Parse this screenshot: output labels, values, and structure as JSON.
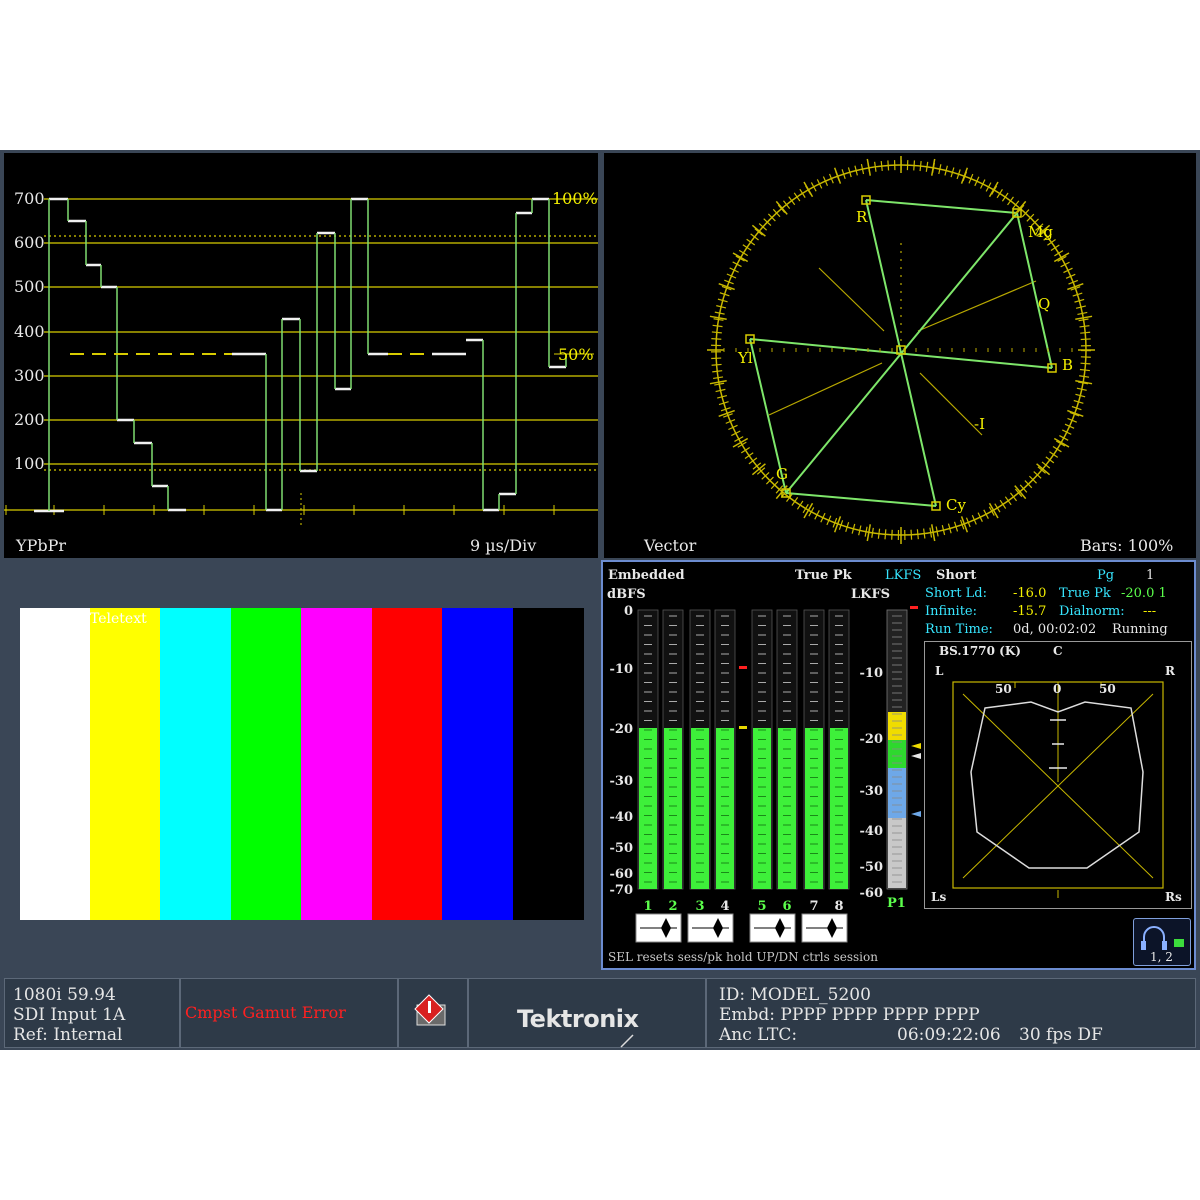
{
  "waveform": {
    "y_ticks": [
      "700",
      "600",
      "500",
      "400",
      "300",
      "200",
      "100"
    ],
    "pct_100": "100%",
    "pct_50": "50%",
    "mode": "YPbPr",
    "timebase": "9 µs/Div"
  },
  "vector": {
    "title": "Vector",
    "bars": "Bars: 100%",
    "targets": {
      "r": "R",
      "mg": "Mg",
      "q": "Q",
      "b": "B",
      "yl": "Yl",
      "i": "-I",
      "g": "G",
      "cy": "Cy"
    }
  },
  "picture": {
    "colors": [
      "#ffffff",
      "#ffff00",
      "#00ffff",
      "#00ff00",
      "#ff00ff",
      "#ff0000",
      "#0000ff",
      "#000000"
    ],
    "overlay": "Teletext"
  },
  "audio": {
    "source": "Embedded",
    "true_pk": "True Pk",
    "lkfs_mode": "LKFS",
    "unit_left": "dBFS",
    "unit_right": "LKFS",
    "dbfs_ticks": [
      "0",
      "-10",
      "-20",
      "-30",
      "-40",
      "-50",
      "-60",
      "-70"
    ],
    "lkfs_ticks": [
      "-10",
      "-20",
      "-30",
      "-40",
      "-50",
      "-60"
    ],
    "channels": [
      "1",
      "2",
      "3",
      "4",
      "5",
      "6",
      "7",
      "8"
    ],
    "channel_levels_dbfs": [
      -20,
      -20,
      -20,
      -20,
      -20,
      -20,
      -20,
      -20
    ],
    "program_label": "P1",
    "session": {
      "short_label": "Short",
      "pg_label": "Pg",
      "pg_value": "1",
      "short_ld_label": "Short Ld:",
      "short_ld_value": "-16.0",
      "true_pk_label": "True Pk",
      "true_pk_value": "-20.0 1",
      "infinite_label": "Infinite:",
      "infinite_value": "-15.7",
      "dialnorm_label": "Dialnorm:",
      "dialnorm_value": "---",
      "run_time_label": "Run Time:",
      "run_time_value": "0d, 00:02:02",
      "state": "Running"
    },
    "surround": {
      "title": "BS.1770 (K)",
      "c": "C",
      "l": "L",
      "r": "R",
      "ls": "Ls",
      "rs": "Rs",
      "scale_left": "50",
      "scale_mid": "0",
      "scale_right": "50"
    },
    "footer": "SEL resets sess/pk hold  UP/DN ctrls session",
    "headphone_channels": "1, 2"
  },
  "status": {
    "format": "1080i 59.94",
    "input": "SDI Input 1A",
    "reference": "Ref: Internal",
    "alarm": "Cmpst Gamut Error",
    "logo": "Tektronix",
    "id": "ID: MODEL_5200",
    "embd": "Embd: PPPP PPPP PPPP PPPP",
    "anc_label": "Anc LTC:",
    "anc_time": "06:09:22:06",
    "anc_rate": "30 fps DF"
  }
}
